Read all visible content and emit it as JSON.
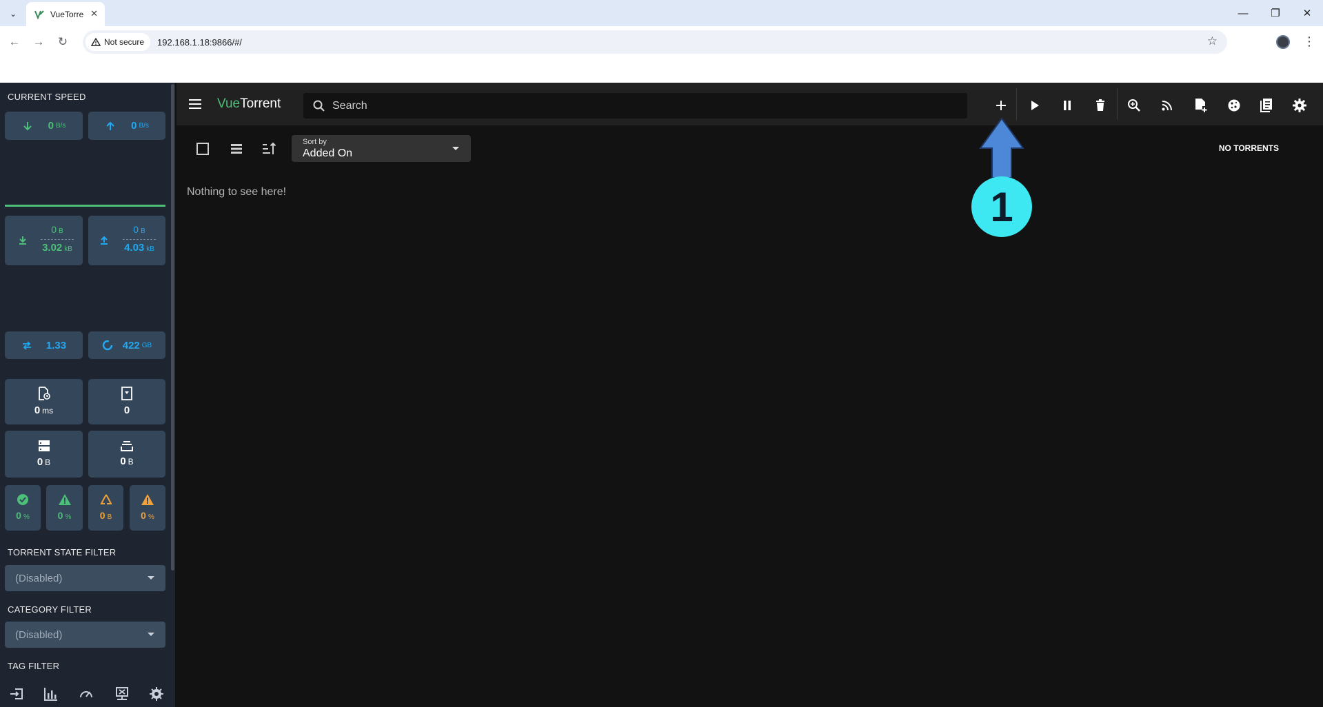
{
  "browser": {
    "tab_title": "VueTorre",
    "security_label": "Not secure",
    "url": "192.168.1.18:9866/#/"
  },
  "sidebar": {
    "current_speed_title": "CURRENT SPEED",
    "download_speed": "0",
    "download_speed_unit": "B/s",
    "upload_speed": "0",
    "upload_speed_unit": "B/s",
    "session_downloaded": "0",
    "session_downloaded_unit": "B",
    "alltime_downloaded": "3.02",
    "alltime_downloaded_unit": "kB",
    "session_uploaded": "0",
    "session_uploaded_unit": "B",
    "alltime_uploaded": "4.03",
    "alltime_uploaded_unit": "kB",
    "ratio": "1.33",
    "free_space": "422",
    "free_space_unit": "GB",
    "queue_time": "0",
    "queue_time_unit": "ms",
    "queued_io": "0",
    "buffer_size": "0",
    "buffer_size_unit": "B",
    "cache_size": "0",
    "cache_size_unit": "B",
    "read_cache_hits": "0",
    "read_cache_hits_unit": "%",
    "write_cache_overload": "0",
    "write_cache_overload_unit": "%",
    "wasted": "0",
    "wasted_unit": "B",
    "read_cache_overload": "0",
    "read_cache_overload_unit": "%",
    "state_filter_title": "TORRENT STATE FILTER",
    "state_filter_value": "(Disabled)",
    "category_filter_title": "CATEGORY FILTER",
    "category_filter_value": "(Disabled)",
    "tag_filter_title": "TAG FILTER"
  },
  "topbar": {
    "brand_vue": "Vue",
    "brand_torrent": "Torrent",
    "search_placeholder": "Search"
  },
  "list": {
    "sort_label": "Sort by",
    "sort_value": "Added On",
    "empty_text": "Nothing to see here!",
    "torrent_count": "NO TORRENTS"
  },
  "annotation": {
    "number": "1"
  },
  "colors": {
    "accent_green": "#4cbf78",
    "accent_blue": "#21a8f0",
    "accent_orange": "#f0a13a",
    "callout": "#3de8f2"
  }
}
